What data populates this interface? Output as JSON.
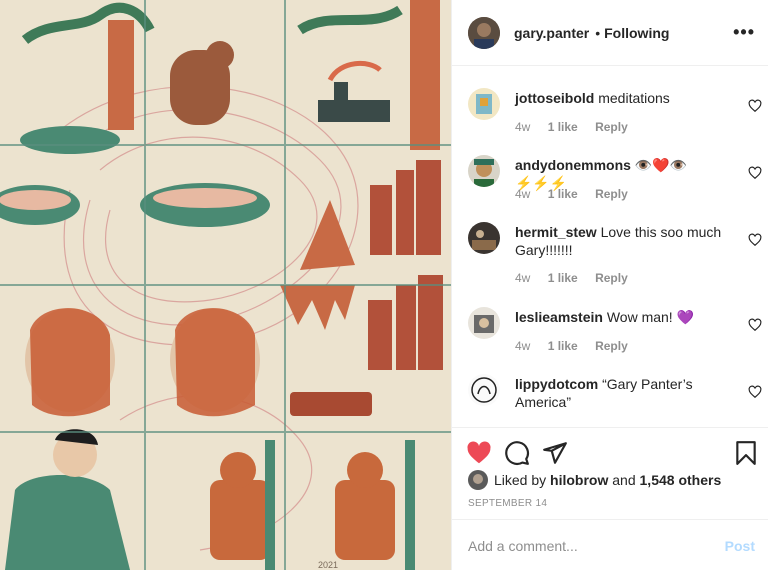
{
  "post": {
    "author": "gary.panter",
    "follow_dot": "•",
    "follow_status": "Following",
    "more_icon": "more-horizontal-icon",
    "artwork_signature": "2021"
  },
  "comments": [
    {
      "username": "jottoseibold",
      "text": "meditations",
      "age": "4w",
      "likes": "1 like",
      "reply": "Reply"
    },
    {
      "username": "andydonemmons",
      "text": "👁️❤️👁️⚡⚡⚡",
      "age": "4w",
      "likes": "1 like",
      "reply": "Reply"
    },
    {
      "username": "hermit_stew",
      "text": "Love this soo much Gary!!!!!!!",
      "age": "4w",
      "likes": "1 like",
      "reply": "Reply"
    },
    {
      "username": "leslieamstein",
      "text": "Wow man! 💜",
      "age": "4w",
      "likes": "1 like",
      "reply": "Reply"
    },
    {
      "username": "lippydotcom",
      "text": "“Gary Panter’s America”"
    }
  ],
  "actions": {
    "like_icon": "heart-filled-icon",
    "comment_icon": "comment-icon",
    "share_icon": "share-icon",
    "save_icon": "bookmark-icon",
    "liked_prefix": "Liked by",
    "liked_user": "hilobrow",
    "liked_and": "and",
    "liked_others": "1,548 others",
    "date": "SEPTEMBER 14"
  },
  "add_comment": {
    "placeholder": "Add a comment...",
    "post_label": "Post"
  },
  "colors": {
    "like_red": "#ed4956",
    "post_disabled": "#b3dbff",
    "secondary_text": "#8e8e8e",
    "divider": "#efefef"
  }
}
